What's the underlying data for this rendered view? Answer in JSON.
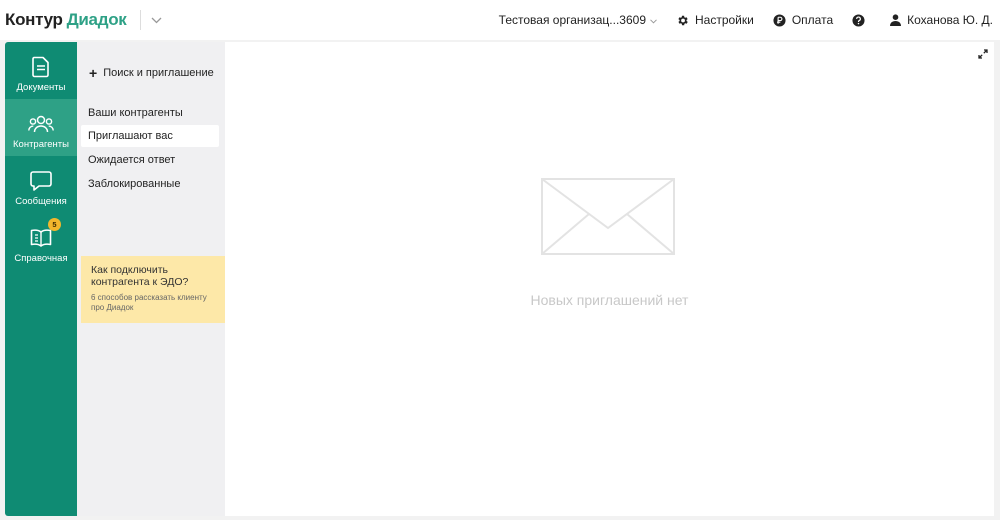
{
  "header": {
    "logo_part1": "Контур",
    "logo_part2": "Диадок",
    "org_name": "Тестовая организац...3609",
    "settings_label": "Настройки",
    "payment_label": "Оплата",
    "user_name": "Коханова Ю. Д.",
    "icons": [
      "chevron-down-icon",
      "gear-icon",
      "ruble-icon",
      "help-icon",
      "user-icon"
    ]
  },
  "sidebar": {
    "items": [
      {
        "label": "Документы",
        "icon": "document-icon"
      },
      {
        "label": "Контрагенты",
        "icon": "contacts-icon",
        "active": true
      },
      {
        "label": "Сообщения",
        "icon": "chat-icon"
      },
      {
        "label": "Справочная",
        "icon": "book-icon",
        "badge": "5"
      }
    ]
  },
  "subnav": {
    "search_invite": "Поиск и приглашение",
    "items": [
      {
        "label": "Ваши контрагенты"
      },
      {
        "label": "Приглашают вас",
        "selected": true
      },
      {
        "label": "Ожидается ответ"
      },
      {
        "label": "Заблокированные"
      }
    ],
    "tip": {
      "title": "Как подключить контрагента к ЭДО?",
      "subtitle": "6 способов рассказать клиенту про Диадок"
    }
  },
  "main": {
    "empty_text": "Новых приглашений нет",
    "icons": [
      "expand-icon",
      "envelope-icon"
    ]
  },
  "colors": {
    "brand_green": "#0f8b73",
    "active_green": "#2ea186",
    "badge_yellow": "#f2b62c",
    "tip_yellow": "#fde8a8"
  }
}
